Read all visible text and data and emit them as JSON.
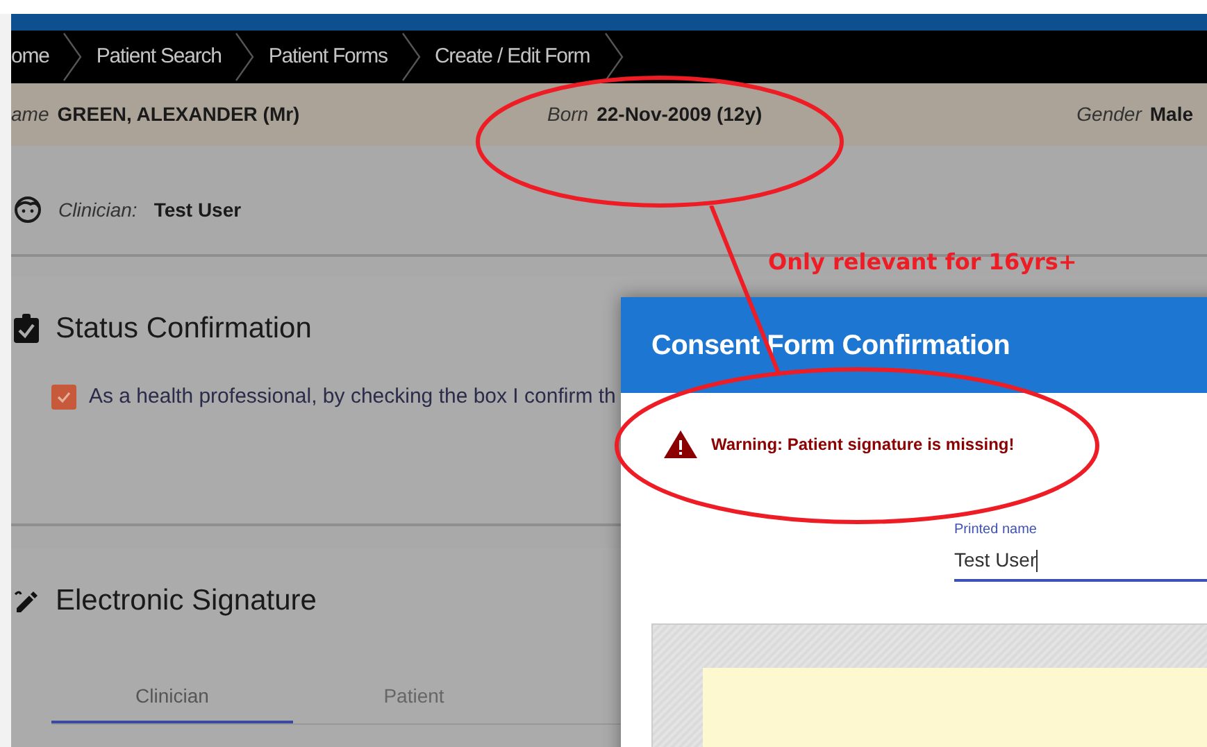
{
  "breadcrumbs": [
    "ome",
    "Patient Search",
    "Patient Forms",
    "Create / Edit Form"
  ],
  "patient_banner": [
    {
      "label": "ame",
      "value": "GREEN, ALEXANDER (Mr)"
    },
    {
      "label": "Born",
      "value": "22-Nov-2009 (12y)"
    },
    {
      "label": "Gender",
      "value": "Male"
    }
  ],
  "clinician": {
    "label": "Clinician:",
    "value": "Test User"
  },
  "status_confirmation": {
    "title": "Status Confirmation",
    "checkbox": {
      "label": "As a health professional, by checking the box I confirm th",
      "checked": true
    }
  },
  "electronic_signature": {
    "title": "Electronic Signature",
    "tabs": [
      {
        "label": "Clinician",
        "selected": true
      },
      {
        "label": "Patient",
        "selected": false
      }
    ]
  },
  "dialog": {
    "title": "Consent Form Confirmation",
    "warning": "Warning: Patient signature is missing!",
    "printed_name": {
      "label": "Printed name",
      "value": "Test User"
    }
  },
  "annotation": {
    "note": "Only relevant for 16yrs+"
  }
}
